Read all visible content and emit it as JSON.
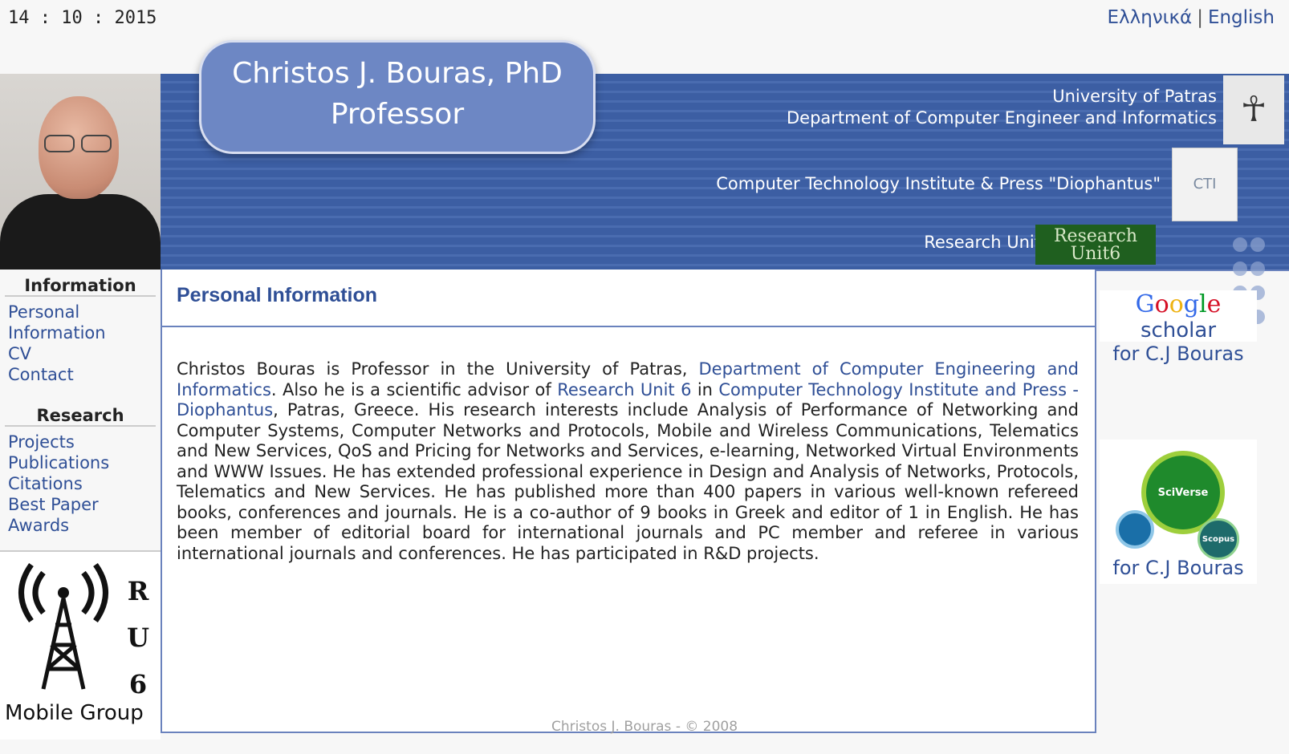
{
  "topbar": {
    "date": "14 : 10 : 2015",
    "lang_greek": "Ελληνικά",
    "lang_sep": "|",
    "lang_english": "English"
  },
  "banner": {
    "title_line1": "Christos J. Bouras, PhD",
    "title_line2": "Professor",
    "uni_line1": "University of Patras",
    "uni_line2": "Department of Computer Engineer and Informatics",
    "cti": "Computer Technology Institute & Press \"Diophantus\"",
    "ru": "Research Unit 6",
    "ru_logo": "Research Unit6",
    "cti_logo": "CTI"
  },
  "sidebar": {
    "info_title": "Information",
    "info_items": [
      "Personal Information",
      "CV",
      "Contact"
    ],
    "research_title": "Research",
    "research_items": [
      "Projects",
      "Publications",
      "Citations",
      "Best Paper Awards"
    ],
    "rumg": {
      "letters": [
        "R",
        "U",
        "6"
      ],
      "label": "Mobile Group"
    }
  },
  "main": {
    "heading": "Personal Information",
    "p_start": "Christos Bouras is Professor in the University of Patras, ",
    "link_dept": "Department of Computer Engineering and Informatics",
    "p_mid1": ". Also he is a scientific advisor of ",
    "link_ru6": "Research Unit 6",
    "p_mid2": " in ",
    "link_cti": "Computer Technology Institute and Press - Diophantus",
    "p_end": ", Patras, Greece. His research interests include Analysis of Performance of Networking and Computer Systems, Computer Networks and Protocols, Mobile and Wireless Communications, Telematics and New Services, QoS and Pricing for Networks and Services, e-learning, Networked Virtual Environments and WWW Issues. He has extended professional experience in Design and Analysis of Networks, Protocols, Telematics and New Services. He has published more than 400 papers in various well-known refereed books, conferences and journals. He is a co-author of 9 books in Greek and editor of 1 in English. He has been member of editorial board for international journals and PC member and referee in various international journals and conferences. He has participated in R&D projects."
  },
  "rightbar": {
    "gs_google": "Google",
    "gs_scholar": "scholar",
    "gs_for": "for C.J Bouras",
    "sv_sciverse": "SciVerse",
    "sv_scopus": "Scopus",
    "sv_for": "for C.J Bouras"
  },
  "footer": "Christos J. Bouras - © 2008",
  "colors": {
    "link": "#2f4f96",
    "banner": "#3c5ea3",
    "title_box": "#6d87c4"
  }
}
